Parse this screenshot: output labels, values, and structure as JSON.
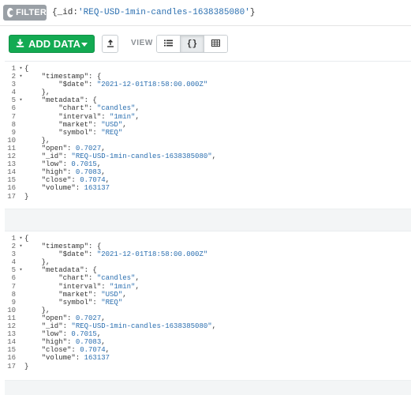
{
  "filter": {
    "label": "FILTER",
    "query_prefix": "{_id:",
    "query_value": "'REQ-USD-1min-candles-1638385080'",
    "query_suffix": "}"
  },
  "toolbar": {
    "add_data_label": "ADD DATA",
    "view_label": "VIEW",
    "views": [
      {
        "name": "list",
        "icon": "list-icon",
        "active": false
      },
      {
        "name": "json",
        "icon": "braces-icon",
        "label": "{}",
        "active": true
      },
      {
        "name": "table",
        "icon": "table-icon",
        "active": false
      }
    ]
  },
  "documents": [
    {
      "lines": [
        {
          "num": "1",
          "fold": "▾",
          "parts": [
            {
              "t": "{",
              "c": "k"
            }
          ]
        },
        {
          "num": "2",
          "fold": "▾",
          "parts": [
            {
              "t": "    \"timestamp\": {",
              "c": "k"
            }
          ]
        },
        {
          "num": "3",
          "fold": "",
          "parts": [
            {
              "t": "        \"$date\": ",
              "c": "k"
            },
            {
              "t": "\"2021-12-01T18:58:00.000Z\"",
              "c": "s"
            }
          ]
        },
        {
          "num": "4",
          "fold": "",
          "parts": [
            {
              "t": "    },",
              "c": "k"
            }
          ]
        },
        {
          "num": "5",
          "fold": "▾",
          "parts": [
            {
              "t": "    \"metadata\": {",
              "c": "k"
            }
          ]
        },
        {
          "num": "6",
          "fold": "",
          "parts": [
            {
              "t": "        \"chart\": ",
              "c": "k"
            },
            {
              "t": "\"candles\"",
              "c": "s"
            },
            {
              "t": ",",
              "c": "k"
            }
          ]
        },
        {
          "num": "7",
          "fold": "",
          "parts": [
            {
              "t": "        \"interval\": ",
              "c": "k"
            },
            {
              "t": "\"1min\"",
              "c": "s"
            },
            {
              "t": ",",
              "c": "k"
            }
          ]
        },
        {
          "num": "8",
          "fold": "",
          "parts": [
            {
              "t": "        \"market\": ",
              "c": "k"
            },
            {
              "t": "\"USD\"",
              "c": "s"
            },
            {
              "t": ",",
              "c": "k"
            }
          ]
        },
        {
          "num": "9",
          "fold": "",
          "parts": [
            {
              "t": "        \"symbol\": ",
              "c": "k"
            },
            {
              "t": "\"REQ\"",
              "c": "s"
            }
          ]
        },
        {
          "num": "10",
          "fold": "",
          "parts": [
            {
              "t": "    },",
              "c": "k"
            }
          ]
        },
        {
          "num": "11",
          "fold": "",
          "parts": [
            {
              "t": "    \"open\": ",
              "c": "k"
            },
            {
              "t": "0.7027",
              "c": "n"
            },
            {
              "t": ",",
              "c": "k"
            }
          ]
        },
        {
          "num": "12",
          "fold": "",
          "parts": [
            {
              "t": "    \"_id\": ",
              "c": "k"
            },
            {
              "t": "\"REQ-USD-1min-candles-1638385080\"",
              "c": "s"
            },
            {
              "t": ",",
              "c": "k"
            }
          ]
        },
        {
          "num": "13",
          "fold": "",
          "parts": [
            {
              "t": "    \"low\": ",
              "c": "k"
            },
            {
              "t": "0.7015",
              "c": "n"
            },
            {
              "t": ",",
              "c": "k"
            }
          ]
        },
        {
          "num": "14",
          "fold": "",
          "parts": [
            {
              "t": "    \"high\": ",
              "c": "k"
            },
            {
              "t": "0.7083",
              "c": "n"
            },
            {
              "t": ",",
              "c": "k"
            }
          ]
        },
        {
          "num": "15",
          "fold": "",
          "parts": [
            {
              "t": "    \"close\": ",
              "c": "k"
            },
            {
              "t": "0.7074",
              "c": "n"
            },
            {
              "t": ",",
              "c": "k"
            }
          ]
        },
        {
          "num": "16",
          "fold": "",
          "parts": [
            {
              "t": "    \"volume\": ",
              "c": "k"
            },
            {
              "t": "163137",
              "c": "n"
            }
          ]
        },
        {
          "num": "17",
          "fold": "",
          "parts": [
            {
              "t": "}",
              "c": "k"
            }
          ]
        }
      ]
    },
    {
      "lines": [
        {
          "num": "1",
          "fold": "▾",
          "parts": [
            {
              "t": "{",
              "c": "k"
            }
          ]
        },
        {
          "num": "2",
          "fold": "▾",
          "parts": [
            {
              "t": "    \"timestamp\": {",
              "c": "k"
            }
          ]
        },
        {
          "num": "3",
          "fold": "",
          "parts": [
            {
              "t": "        \"$date\": ",
              "c": "k"
            },
            {
              "t": "\"2021-12-01T18:58:00.000Z\"",
              "c": "s"
            }
          ]
        },
        {
          "num": "4",
          "fold": "",
          "parts": [
            {
              "t": "    },",
              "c": "k"
            }
          ]
        },
        {
          "num": "5",
          "fold": "▾",
          "parts": [
            {
              "t": "    \"metadata\": {",
              "c": "k"
            }
          ]
        },
        {
          "num": "6",
          "fold": "",
          "parts": [
            {
              "t": "        \"chart\": ",
              "c": "k"
            },
            {
              "t": "\"candles\"",
              "c": "s"
            },
            {
              "t": ",",
              "c": "k"
            }
          ]
        },
        {
          "num": "7",
          "fold": "",
          "parts": [
            {
              "t": "        \"interval\": ",
              "c": "k"
            },
            {
              "t": "\"1min\"",
              "c": "s"
            },
            {
              "t": ",",
              "c": "k"
            }
          ]
        },
        {
          "num": "8",
          "fold": "",
          "parts": [
            {
              "t": "        \"market\": ",
              "c": "k"
            },
            {
              "t": "\"USD\"",
              "c": "s"
            },
            {
              "t": ",",
              "c": "k"
            }
          ]
        },
        {
          "num": "9",
          "fold": "",
          "parts": [
            {
              "t": "        \"symbol\": ",
              "c": "k"
            },
            {
              "t": "\"REQ\"",
              "c": "s"
            }
          ]
        },
        {
          "num": "10",
          "fold": "",
          "parts": [
            {
              "t": "    },",
              "c": "k"
            }
          ]
        },
        {
          "num": "11",
          "fold": "",
          "parts": [
            {
              "t": "    \"open\": ",
              "c": "k"
            },
            {
              "t": "0.7027",
              "c": "n"
            },
            {
              "t": ",",
              "c": "k"
            }
          ]
        },
        {
          "num": "12",
          "fold": "",
          "parts": [
            {
              "t": "    \"_id\": ",
              "c": "k"
            },
            {
              "t": "\"REQ-USD-1min-candles-1638385080\"",
              "c": "s"
            },
            {
              "t": ",",
              "c": "k"
            }
          ]
        },
        {
          "num": "13",
          "fold": "",
          "parts": [
            {
              "t": "    \"low\": ",
              "c": "k"
            },
            {
              "t": "0.7015",
              "c": "n"
            },
            {
              "t": ",",
              "c": "k"
            }
          ]
        },
        {
          "num": "14",
          "fold": "",
          "parts": [
            {
              "t": "    \"high\": ",
              "c": "k"
            },
            {
              "t": "0.7083",
              "c": "n"
            },
            {
              "t": ",",
              "c": "k"
            }
          ]
        },
        {
          "num": "15",
          "fold": "",
          "parts": [
            {
              "t": "    \"close\": ",
              "c": "k"
            },
            {
              "t": "0.7074",
              "c": "n"
            },
            {
              "t": ",",
              "c": "k"
            }
          ]
        },
        {
          "num": "16",
          "fold": "",
          "parts": [
            {
              "t": "    \"volume\": ",
              "c": "k"
            },
            {
              "t": "163137",
              "c": "n"
            }
          ]
        },
        {
          "num": "17",
          "fold": "",
          "parts": [
            {
              "t": "}",
              "c": "k"
            }
          ]
        }
      ]
    }
  ],
  "colors": {
    "add_button": "#13aa52",
    "filter_pill": "#9aa0a6",
    "string_value": "#2b6fb0"
  }
}
